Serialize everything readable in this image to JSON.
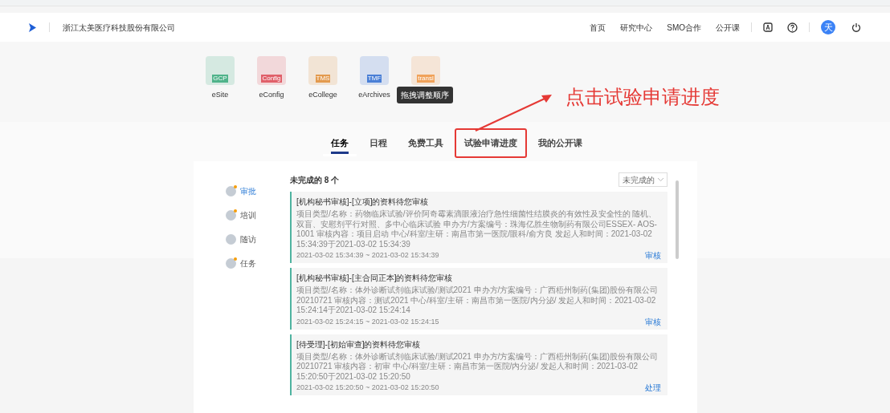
{
  "header": {
    "company": "浙江太美医疗科技股份有限公司",
    "nav": [
      "首页",
      "研究中心",
      "SMO合作",
      "公开课"
    ],
    "avatar": "天"
  },
  "apps": [
    {
      "label": "eSite",
      "badge": "GCP",
      "color": "#4fb38a"
    },
    {
      "label": "eConfig",
      "badge": "Config",
      "color": "#e0606a"
    },
    {
      "label": "eCollege",
      "badge": "TMS",
      "color": "#e39a4e"
    },
    {
      "label": "eArchives",
      "badge": "TMF",
      "color": "#4a7fd6"
    },
    {
      "badge": "transl",
      "color": "#f0a25a"
    }
  ],
  "tooltip": "拖拽调整顺序",
  "annotation": {
    "text": "点击试验申请进度"
  },
  "tabs": [
    {
      "label": "任务",
      "selected": true,
      "highlighted": false
    },
    {
      "label": "日程",
      "selected": false,
      "highlighted": false
    },
    {
      "label": "免费工具",
      "selected": false,
      "highlighted": false
    },
    {
      "label": "试验申请进度",
      "selected": false,
      "highlighted": true
    },
    {
      "label": "我的公开课",
      "selected": false,
      "highlighted": false
    }
  ],
  "sidebar": {
    "items": [
      {
        "label": "审批",
        "selected": true,
        "dot": true
      },
      {
        "label": "培训",
        "selected": false,
        "dot": true
      },
      {
        "label": "随访",
        "selected": false,
        "dot": false
      },
      {
        "label": "任务",
        "selected": false,
        "dot": true
      }
    ]
  },
  "list": {
    "summary": "未完成的 8 个",
    "filter": "未完成的",
    "cards": [
      {
        "title": "[机构秘书审核]-[立项]的资料待您审核",
        "detail": "项目类型/名称：药物临床试验/评价阿奇霉素滴眼液治疗急性细菌性结膜炎的有效性及安全性的 随机、双盲、安慰剂平行对照、多中心临床试验 申办方/方案编号：珠海亿胜生物制药有限公司ESSEX- AOS-1001 审核内容：项目启动 中心/科室/主研：南昌市第一医院/眼科/俞方良 发起人和时间：2021-03-02 15:34:39于2021-03-02 15:34:39",
        "time": "2021-03-02 15:34:39 ~ 2021-03-02 15:34:39",
        "action": "审核"
      },
      {
        "title": "[机构秘书审核]-[主合同正本]的资料待您审核",
        "detail": "项目类型/名称：体外诊断试剂临床试验/测试2021 申办方/方案编号：广西梧州制药(集团)股份有限公司20210721 审核内容：测试2021 中心/科室/主研：南昌市第一医院/内分泌/ 发起人和时间：2021-03-02 15:24:14于2021-03-02 15:24:14",
        "time": "2021-03-02 15:24:15 ~ 2021-03-02 15:24:15",
        "action": "审核"
      },
      {
        "title": "[待受理]-[初始审查]的资料待您审核",
        "detail": "项目类型/名称：体外诊断试剂临床试验/测试2021 申办方/方案编号：广西梧州制药(集团)股份有限公司20210721 审核内容：初审 中心/科室/主研：南昌市第一医院/内分泌/ 发起人和时间：2021-03-02 15:20:50于2021-03-02 15:20:50",
        "time": "2021-03-02 15:20:50 ~ 2021-03-02 15:20:50",
        "action": "处理"
      }
    ]
  }
}
